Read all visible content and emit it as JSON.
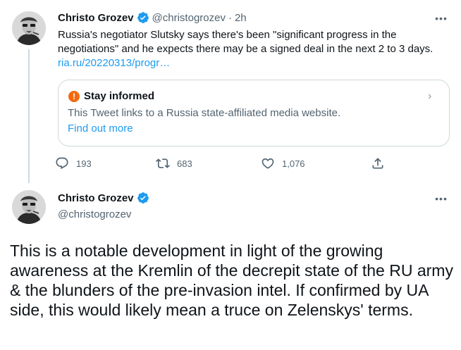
{
  "tweet1": {
    "author_name": "Christo Grozev",
    "handle": "@christogrozev",
    "separator": "·",
    "time": "2h",
    "text": "Russia's negotiator Slutsky says there's been \"significant progress in the negotiations\" and he expects there may be a signed deal in the next 2 to 3 days. ",
    "link_text": "ria.ru/20220313/progr…",
    "more_label": "•••",
    "notice": {
      "title": "Stay informed",
      "description": "This Tweet links to a Russia state-affiliated media website.",
      "link": "Find out more",
      "icon": "!",
      "chevron": "›"
    },
    "replies": "193",
    "retweets": "683",
    "likes": "1,076"
  },
  "tweet2": {
    "author_name": "Christo Grozev",
    "handle": "@christogrozev",
    "more_label": "•••",
    "text": "This is a notable development in light of the growing awareness at the Kremlin of the decrepit state of the RU army & the blunders of the pre-invasion intel. If confirmed by UA side, this would likely mean a truce on Zelenskys' terms."
  },
  "icons": {
    "verified": "verified-badge-icon",
    "reply": "reply-icon",
    "retweet": "retweet-icon",
    "like": "heart-icon",
    "share": "share-icon"
  },
  "colors": {
    "accent": "#1d9bf0",
    "secondary_text": "#536471",
    "border": "#cfd9de",
    "warning": "#f4690f"
  }
}
